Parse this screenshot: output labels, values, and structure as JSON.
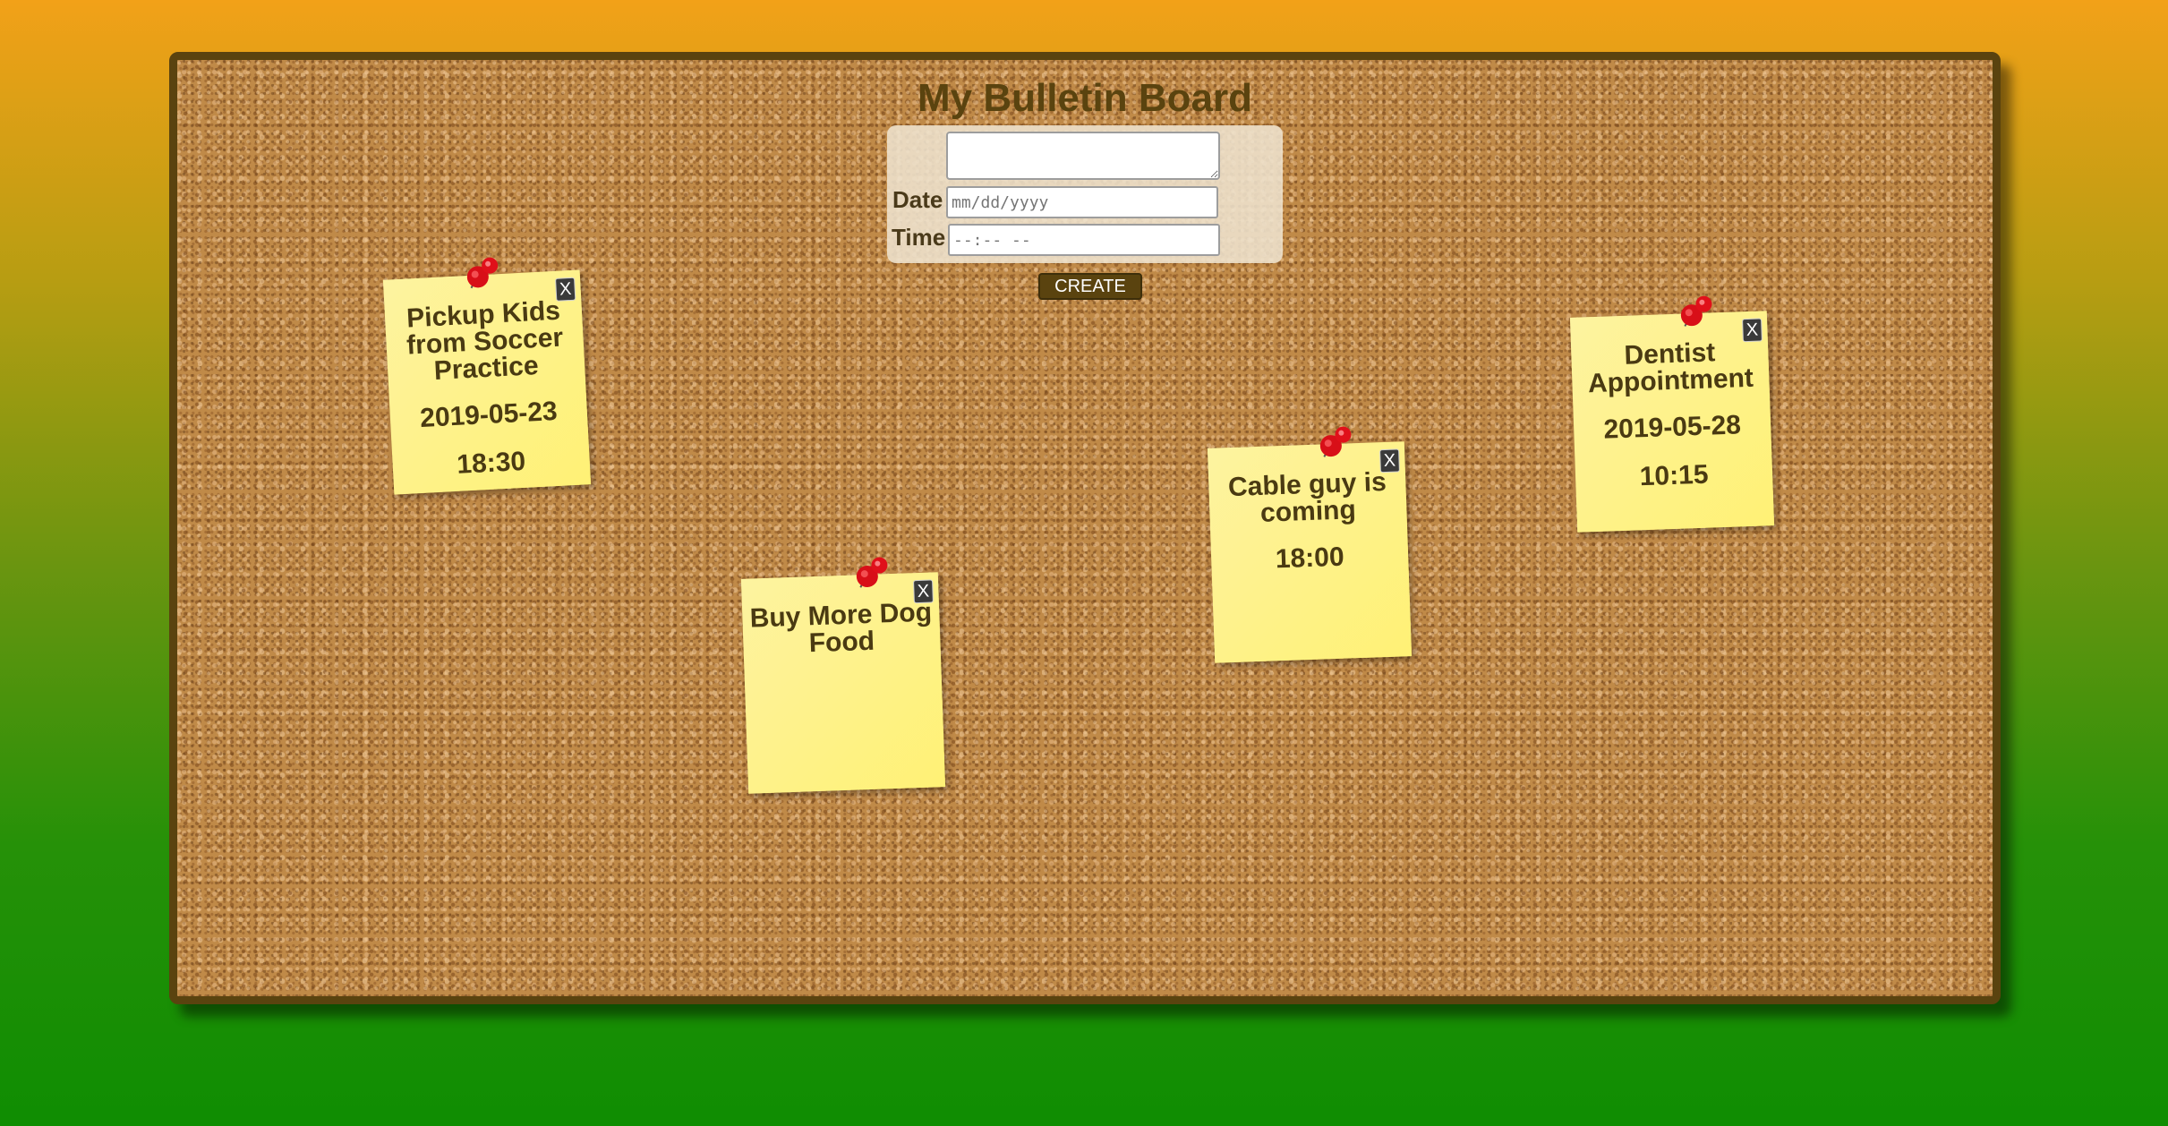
{
  "board": {
    "title": "My Bulletin Board",
    "form": {
      "note_text_value": "",
      "date_label": "Date",
      "date_placeholder": "mm/dd/yyyy",
      "time_label": "Time",
      "time_placeholder": "--:-- --",
      "create_label": "CREATE"
    },
    "notes": [
      {
        "text": "Pickup Kids from Soccer Practice",
        "date": "2019-05-23",
        "time": "18:30",
        "close_label": "X"
      },
      {
        "text": "Buy More Dog Food",
        "date": "",
        "time": "",
        "close_label": "X"
      },
      {
        "text": "Cable guy is coming",
        "date": "",
        "time": "18:00",
        "close_label": "X"
      },
      {
        "text": "Dentist Appointment",
        "date": "2019-05-28",
        "time": "10:15",
        "close_label": "X"
      }
    ]
  },
  "colors": {
    "gradient_top": "#f2a118",
    "gradient_bottom": "#0f8d02",
    "board_frame": "#5a430f",
    "cork": "#c08a48",
    "note_yellow": "#fff175",
    "pin_red": "#e0101a"
  },
  "icons": {
    "pin": "red-push-pin-icon",
    "close": "close-x-icon"
  }
}
